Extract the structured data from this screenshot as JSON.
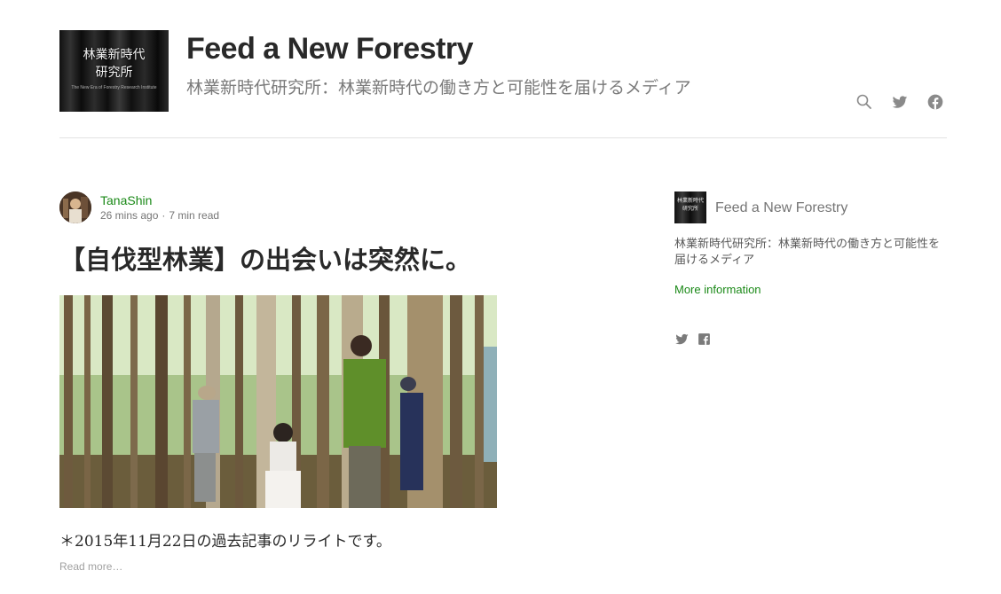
{
  "header": {
    "logo": {
      "line1": "林業新時代",
      "line2": "研究所",
      "subline": "The New Era of Forestry Research Institute"
    },
    "title": "Feed a New Forestry",
    "description": "林業新時代研究所：林業新時代の働き方と可能性を届けるメディア",
    "icons": [
      "search-icon",
      "twitter-icon",
      "facebook-icon"
    ]
  },
  "post": {
    "author": "TanaShin",
    "time_ago": "26 mins ago",
    "separator": "·",
    "read_time": "7 min read",
    "title": "【自伐型林業】の出会いは突然に。",
    "excerpt": "＊2015年11月22日の過去記事のリライトです。",
    "read_more": "Read more…"
  },
  "sidebar": {
    "logo": {
      "line1": "林業新時代",
      "line2": "研究所"
    },
    "title": "Feed a New Forestry",
    "description": "林業新時代研究所：林業新時代の働き方と可能性を届けるメディア",
    "more_info": "More information",
    "icons": [
      "twitter-icon",
      "facebook-icon"
    ]
  },
  "colors": {
    "accent_green": "#1a8917",
    "text_dark": "#292929",
    "text_muted": "#757575",
    "rule": "#e2e2e2"
  }
}
